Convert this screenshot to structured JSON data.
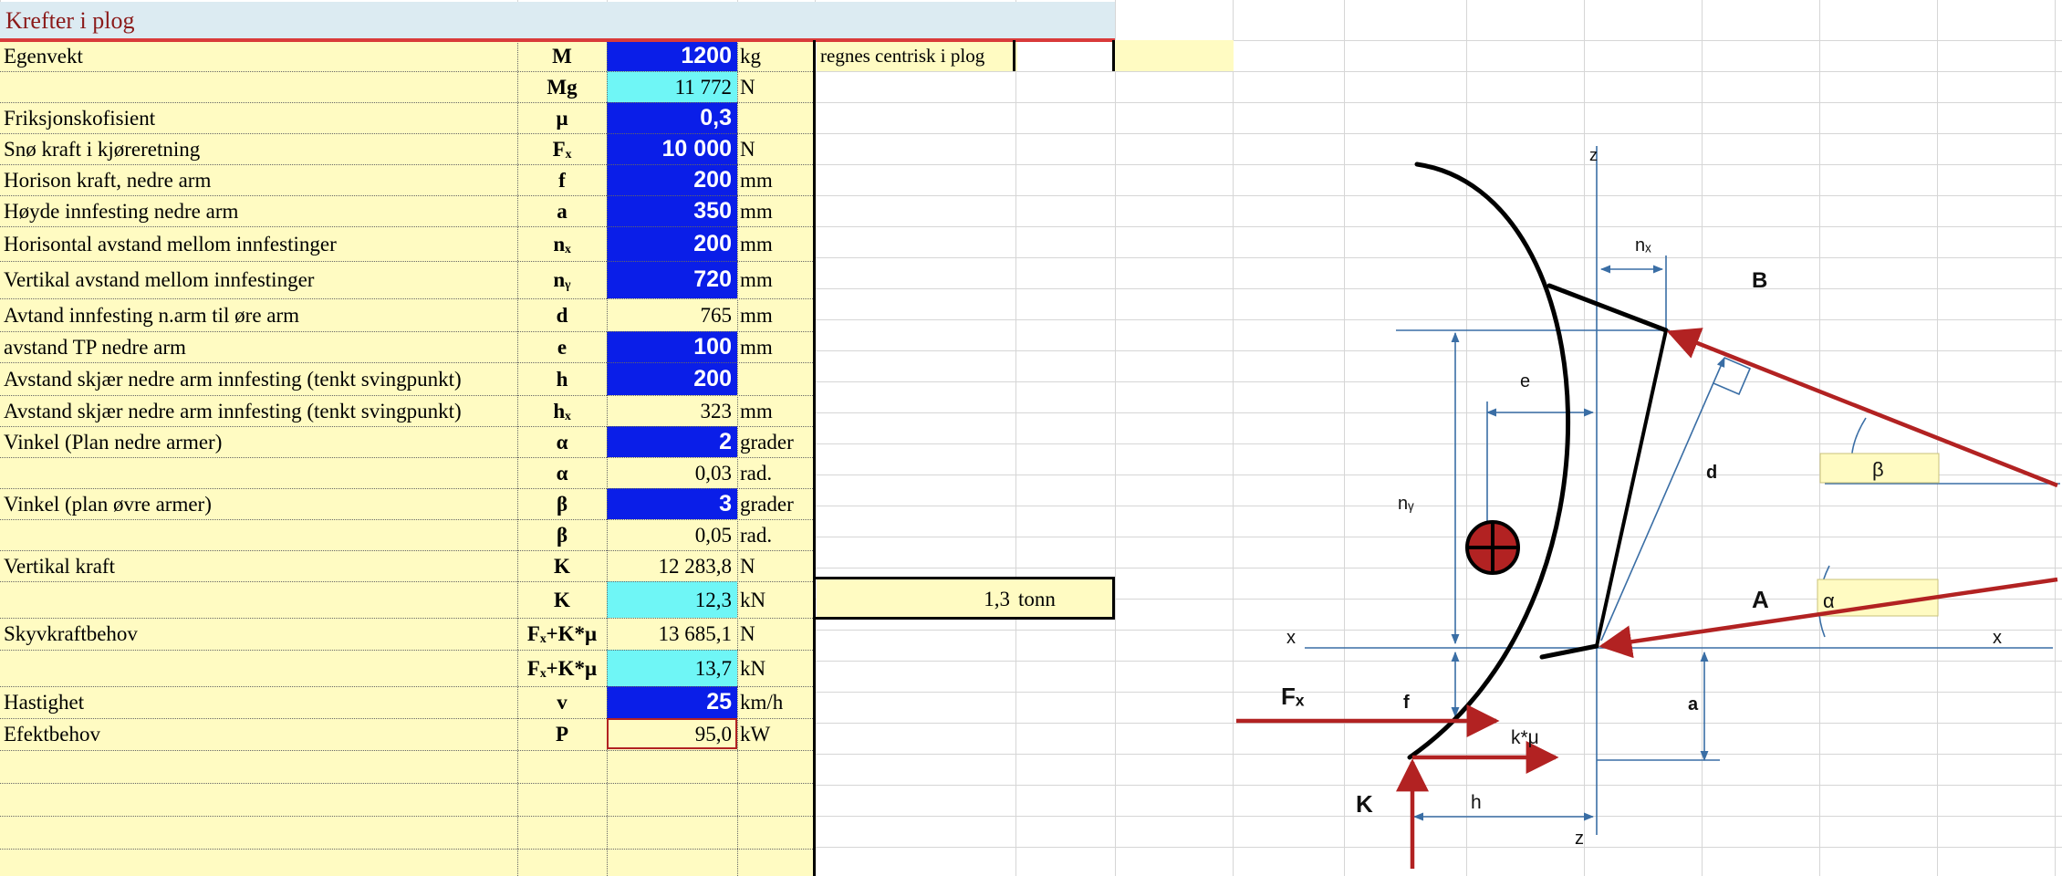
{
  "title": "Krefter i plog",
  "note": "regnes centrisk i plog",
  "tonn": {
    "value": "1,3",
    "unit": "tonn"
  },
  "rows": [
    {
      "label": "Egenvekt",
      "sym": "M",
      "value": "1200",
      "unit": "kg",
      "style": "inp"
    },
    {
      "label": "",
      "sym": "Mg",
      "value": "11 772",
      "unit": "N",
      "style": "cyan"
    },
    {
      "label": "Friksjonskofisient",
      "sym": "μ",
      "value": "0,3",
      "unit": "",
      "style": "inp"
    },
    {
      "label": "Snø kraft i kjøreretning",
      "sym": "Fₓ",
      "value": "10 000",
      "unit": "N",
      "style": "inp"
    },
    {
      "label": "Horison kraft, nedre arm",
      "sym": "f",
      "value": "200",
      "unit": "mm",
      "style": "inp"
    },
    {
      "label": "Høyde innfesting nedre arm",
      "sym": "a",
      "value": "350",
      "unit": "mm",
      "style": "inp"
    },
    {
      "label": "Horisontal avstand mellom innfestinger",
      "sym": "nₓ",
      "value": "200",
      "unit": "mm",
      "style": "inp"
    },
    {
      "label": "Vertikal avstand mellom innfestinger",
      "sym": "nᵧ",
      "value": "720",
      "unit": "mm",
      "style": "inp"
    },
    {
      "label": "Avtand innfesting n.arm til øre arm",
      "sym": "d",
      "value": "765",
      "unit": "mm",
      "style": "ylw"
    },
    {
      "label": "avstand TP nedre arm",
      "sym": "e",
      "value": "100",
      "unit": "mm",
      "style": "inp"
    },
    {
      "label": "Avstand skjær nedre arm innfesting (tenkt svingpunkt)",
      "sym": "h",
      "value": "200",
      "unit": "",
      "style": "inp"
    },
    {
      "label": "Avstand skjær nedre arm innfesting (tenkt svingpunkt)",
      "sym": "hₓ",
      "value": "323",
      "unit": "mm",
      "style": "ylw"
    },
    {
      "label": "Vinkel (Plan nedre armer)",
      "sym": "α",
      "value": "2",
      "unit": "grader",
      "style": "inp"
    },
    {
      "label": "",
      "sym": "α",
      "value": "0,03",
      "unit": "rad.",
      "style": "ylw"
    },
    {
      "label": "Vinkel (plan øvre armer)",
      "sym": "β",
      "value": "3",
      "unit": "grader",
      "style": "inp"
    },
    {
      "label": "",
      "sym": "β",
      "value": "0,05",
      "unit": "rad.",
      "style": "ylw"
    },
    {
      "label": "Vertikal kraft",
      "sym": "K",
      "value": "12 283,8",
      "unit": "N",
      "style": "ylw"
    },
    {
      "label": "",
      "sym": "K",
      "value": "12,3",
      "unit": "kN",
      "style": "cyan"
    },
    {
      "label": "Skyvkraftbehov",
      "sym": "Fₓ+K*μ",
      "value": "13 685,1",
      "unit": "N",
      "style": "ylw"
    },
    {
      "label": "",
      "sym": "Fₓ+K*μ",
      "value": "13,7",
      "unit": "kN",
      "style": "cyan"
    },
    {
      "label": "Hastighet",
      "sym": "v",
      "value": "25",
      "unit": "km/h",
      "style": "inp"
    },
    {
      "label": "Efektbehov",
      "sym": "P",
      "value": "95,0",
      "unit": "kW",
      "style": "ylw"
    }
  ],
  "diagram": {
    "labels": {
      "z_top": "z",
      "z_bottom": "z",
      "x_left": "x",
      "x_right": "x",
      "nx": "nₓ",
      "ny": "nᵧ",
      "e": "e",
      "d": "d",
      "B": "B",
      "A": "A",
      "beta": "β",
      "alpha": "α",
      "Fx": "Fₓ",
      "f": "f",
      "a": "a",
      "kmu": "k*μ",
      "K": "K",
      "h": "h"
    },
    "colors": {
      "force": "#b22222",
      "dim": "#3a6ea5",
      "plow": "#000000",
      "cog": "#b22222",
      "angle_box": "#fffbc2"
    }
  }
}
